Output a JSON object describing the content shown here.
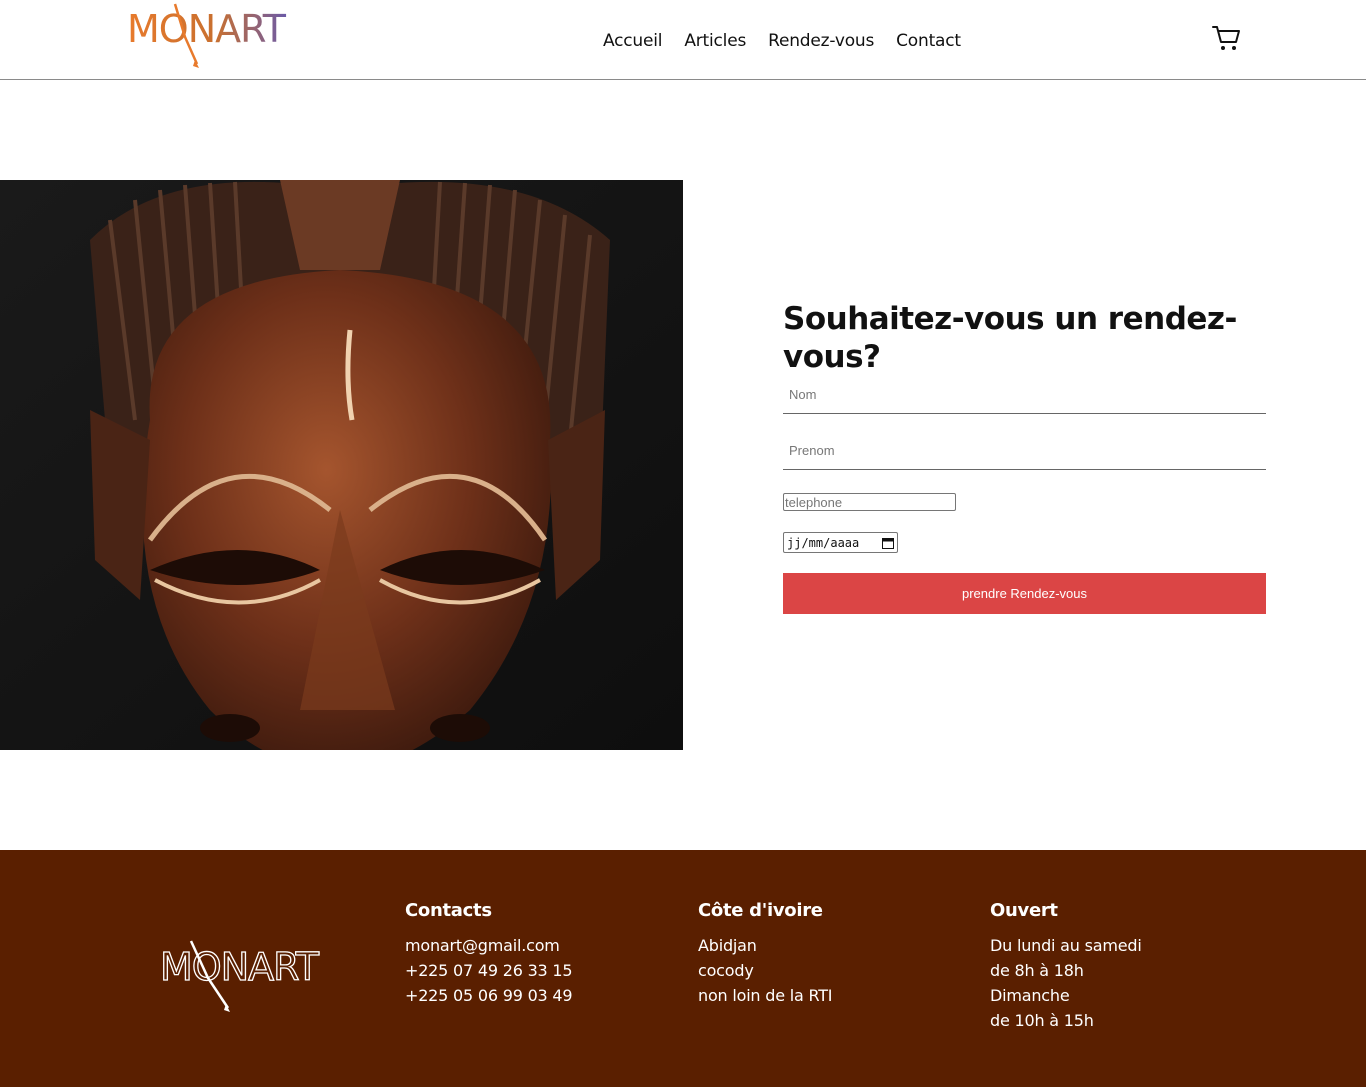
{
  "header": {
    "logo_text": "MONART",
    "nav": [
      "Accueil",
      "Articles",
      "Rendez-vous",
      "Contact"
    ]
  },
  "form": {
    "title": "Souhaitez-vous un rendez-vous?",
    "nom_placeholder": "Nom",
    "prenom_placeholder": "Prenom",
    "telephone_placeholder": "telephone",
    "date_placeholder": "jj/mm/aaaa",
    "submit_label": "prendre Rendez-vous"
  },
  "footer": {
    "logo_text": "MONART",
    "contacts": {
      "title": "Contacts",
      "lines": [
        "monart@gmail.com",
        "+225 07 49 26 33 15",
        "+225 05 06 99 03 49"
      ]
    },
    "location": {
      "title": "Côte d'ivoire",
      "lines": [
        "Abidjan",
        "cocody",
        "non loin de la RTI"
      ]
    },
    "hours": {
      "title": "Ouvert",
      "lines": [
        "Du lundi au samedi",
        "de 8h à 18h",
        "Dimanche",
        "de 10h à 15h"
      ]
    }
  },
  "colors": {
    "accent": "#db4545",
    "footer_bg": "#5a1f00",
    "logo_orange": "#e87a2c",
    "logo_purple": "#6a5aa8"
  }
}
